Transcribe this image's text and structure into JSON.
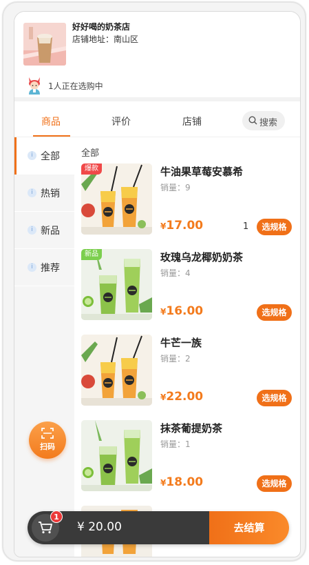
{
  "shop": {
    "name": "好好喝的奶茶店",
    "address": "店铺地址：南山区",
    "browsing_text": "1人正在选购中"
  },
  "tabs": [
    {
      "label": "商品",
      "active": true
    },
    {
      "label": "评价",
      "active": false
    },
    {
      "label": "店铺",
      "active": false
    }
  ],
  "search": {
    "label": "搜索",
    "icon": "search-icon"
  },
  "categories": [
    {
      "label": "全部",
      "active": true
    },
    {
      "label": "热销",
      "active": false
    },
    {
      "label": "新品",
      "active": false
    },
    {
      "label": "推荐",
      "active": false
    }
  ],
  "list_title": "全部",
  "products": [
    {
      "name": "牛油果草莓安慕希",
      "sales": "销量：9",
      "currency": "¥",
      "price": "17.00",
      "qty": "1",
      "badge": "爆款",
      "badge_color": "#f04848",
      "spec_label": "选规格",
      "image": "orange-drinks"
    },
    {
      "name": "玫瑰乌龙椰奶奶茶",
      "sales": "销量：4",
      "currency": "¥",
      "price": "16.00",
      "qty": "",
      "badge": "新品",
      "badge_color": "#7ccf4e",
      "spec_label": "选规格",
      "image": "green-drinks"
    },
    {
      "name": "牛芒一族",
      "sales": "销量：2",
      "currency": "¥",
      "price": "22.00",
      "qty": "",
      "badge": "",
      "badge_color": "",
      "spec_label": "选规格",
      "image": "orange-drinks"
    },
    {
      "name": "抹茶葡提奶茶",
      "sales": "销量：1",
      "currency": "¥",
      "price": "18.00",
      "qty": "",
      "badge": "",
      "badge_color": "",
      "spec_label": "选规格",
      "image": "green-drinks"
    }
  ],
  "scan": {
    "label": "扫码",
    "icon": "scan-icon"
  },
  "cart": {
    "count": "1",
    "total": "¥ 20.00",
    "checkout_label": "去结算",
    "icon": "cart-icon"
  },
  "colors": {
    "accent": "#f07018",
    "price": "#f37b1d",
    "cart_bg": "#3a3a3a",
    "badge_red": "#ec3a3a"
  }
}
